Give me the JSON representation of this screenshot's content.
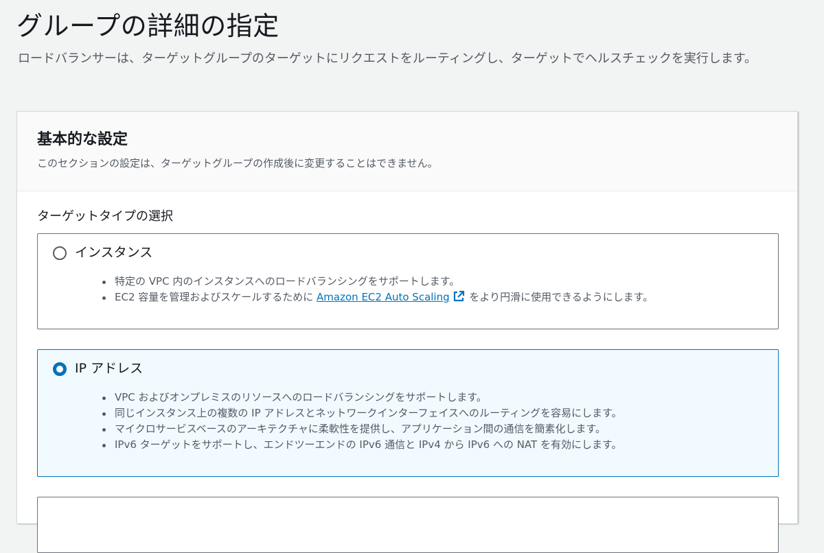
{
  "header": {
    "title": "グループの詳細の指定",
    "description": "ロードバランサーは、ターゲットグループのターゲットにリクエストをルーティングし、ターゲットでヘルスチェックを実行します。"
  },
  "basic_config": {
    "title": "基本的な設定",
    "description": "このセクションの設定は、ターゲットグループの作成後に変更することはできません。",
    "target_type_label": "ターゲットタイプの選択",
    "options": [
      {
        "label": "インスタンス",
        "selected": false,
        "bullets": [
          "特定の VPC 内のインスタンスへのロードバランシングをサポートします。"
        ],
        "bullet2_prefix": "EC2 容量を管理およびスケールするために ",
        "bullet2_link": "Amazon EC2 Auto Scaling",
        "bullet2_suffix": " をより円滑に使用できるようにします。"
      },
      {
        "label": "IP アドレス",
        "selected": true,
        "bullets": [
          "VPC およびオンプレミスのリソースへのロードバランシングをサポートします。",
          "同じインスタンス上の複数の IP アドレスとネットワークインターフェイスへのルーティングを容易にします。",
          "マイクロサービスベースのアーキテクチャに柔軟性を提供し、アプリケーション間の通信を簡素化します。",
          "IPv6 ターゲットをサポートし、エンドツーエンドの IPv6 通信と IPv4 から IPv6 への NAT を有効にします。"
        ]
      }
    ]
  },
  "colors": {
    "accent": "#0073bb",
    "selected_bg": "#f1faff",
    "page_bg": "#f2f3f3"
  },
  "icons": {
    "external_link": "external-link-icon"
  }
}
